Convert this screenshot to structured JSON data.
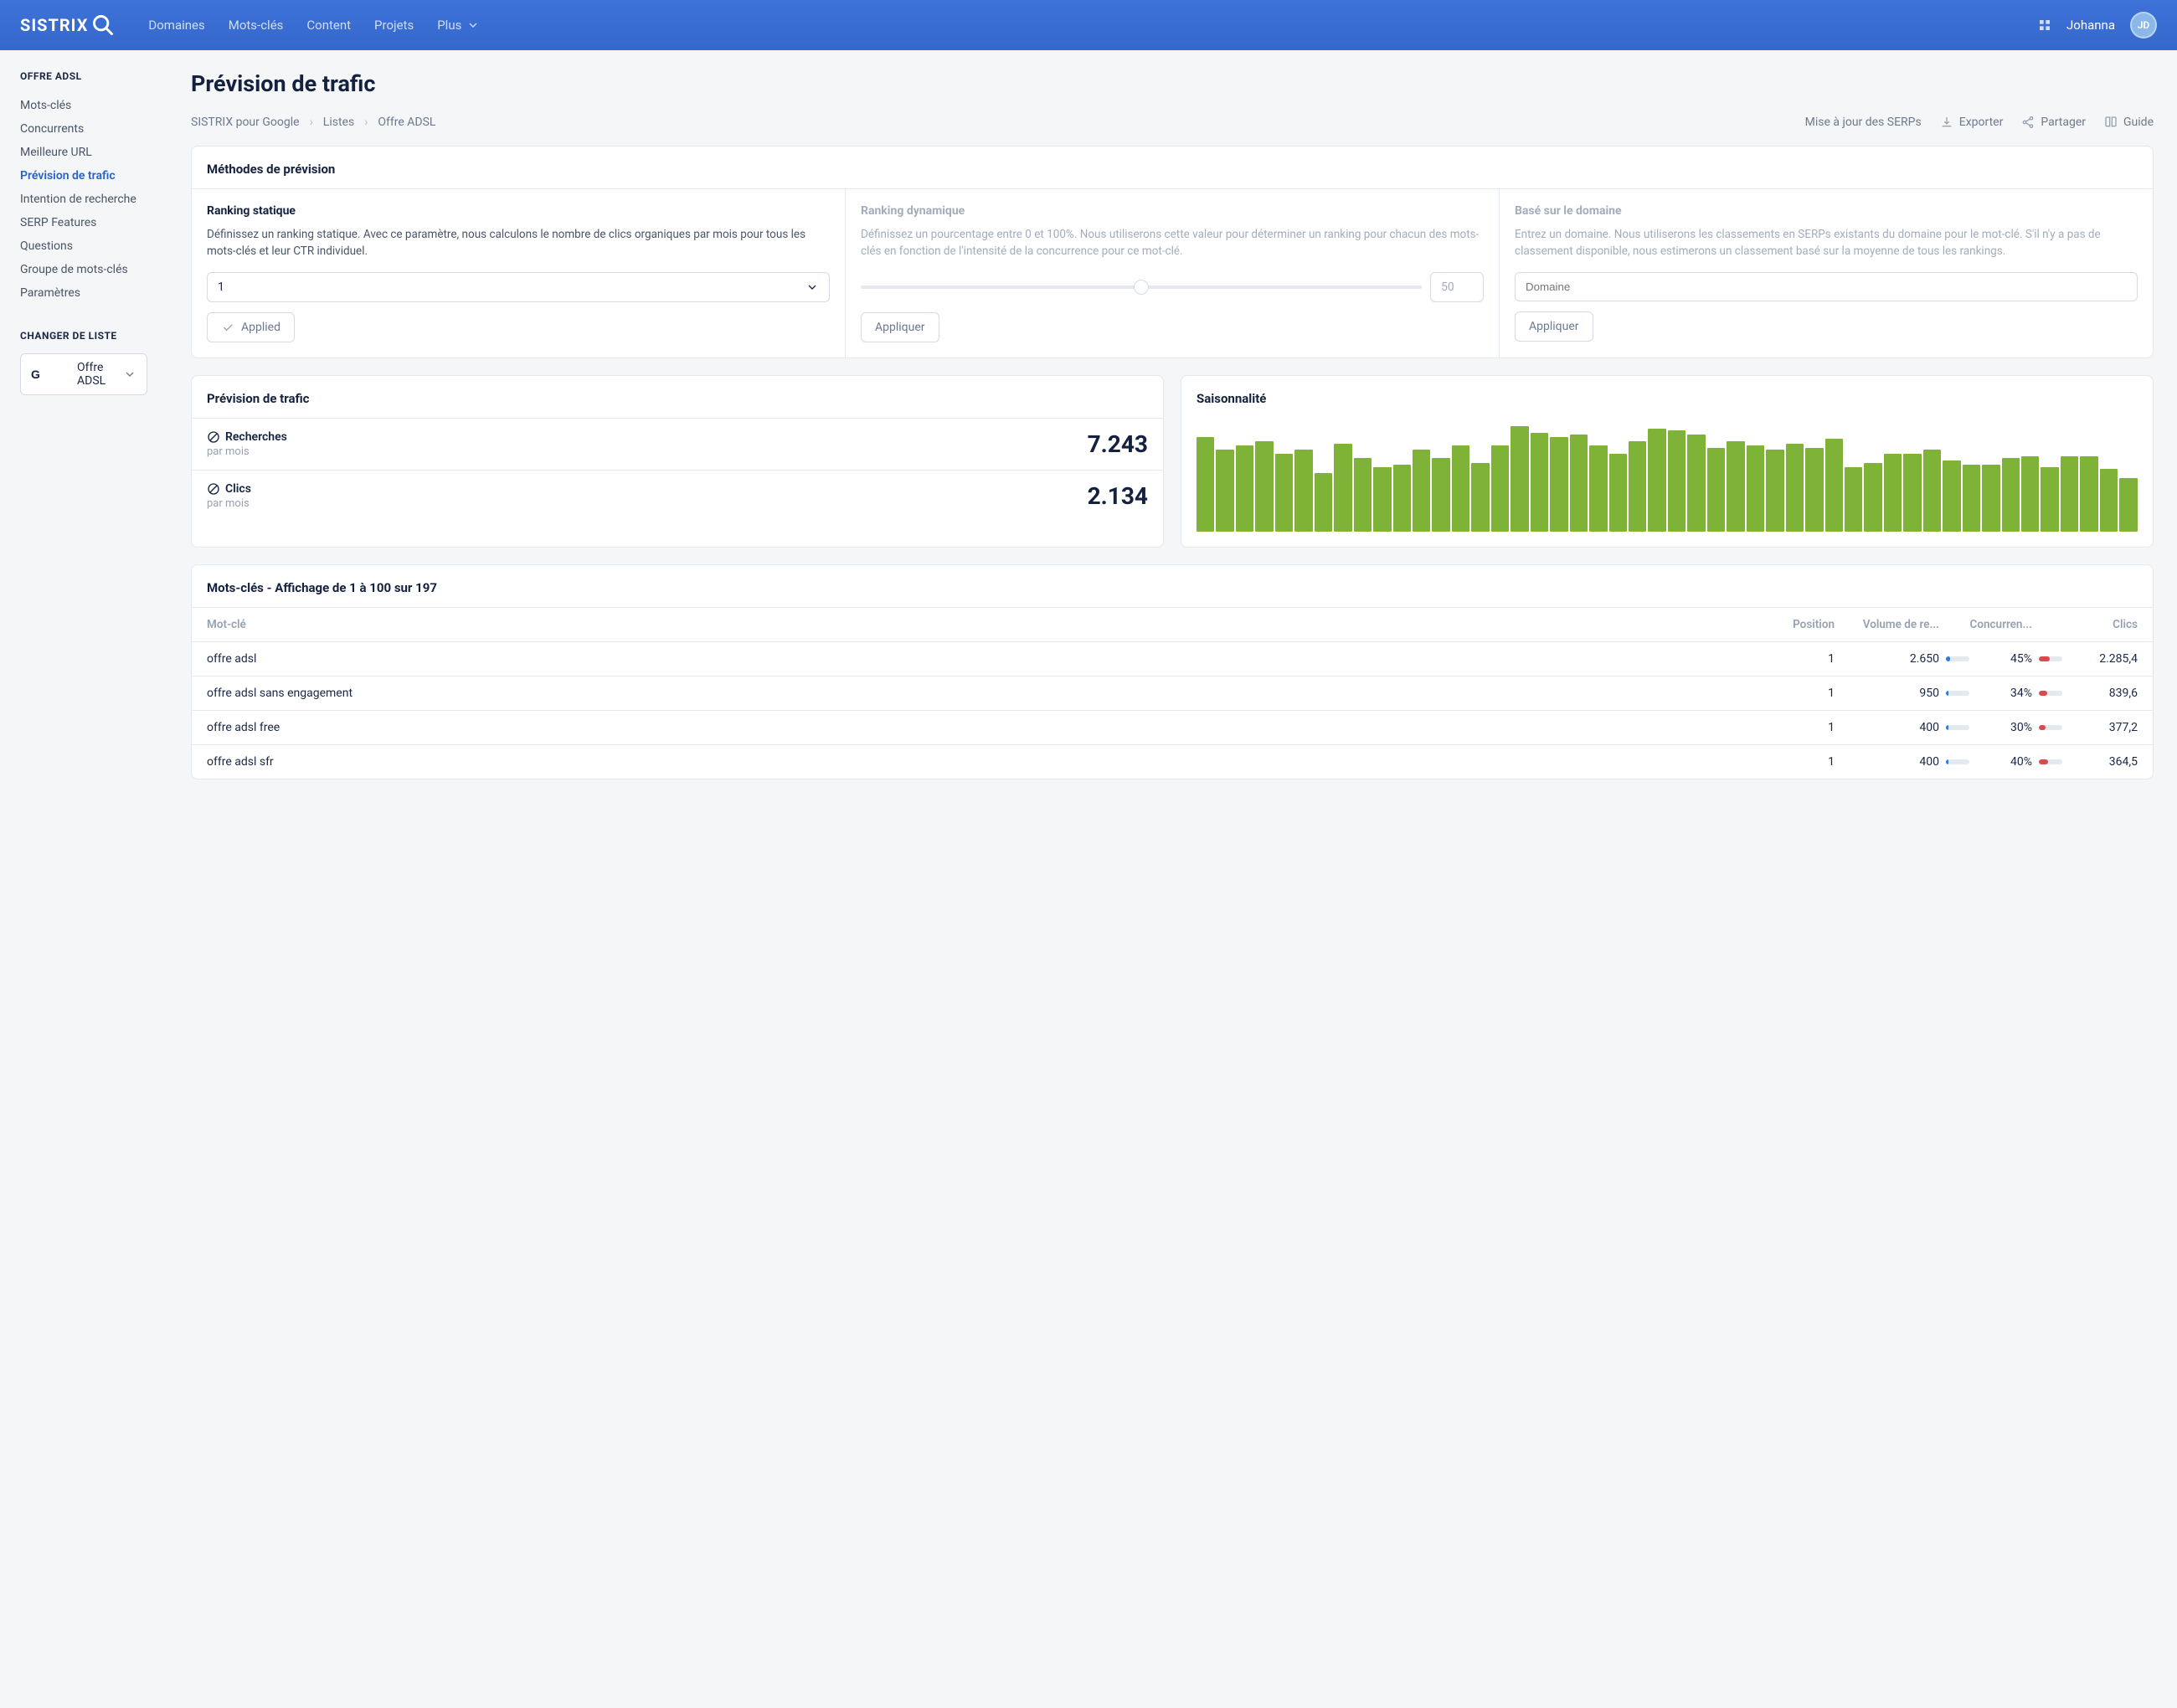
{
  "header": {
    "logo_text": "SISTRIX",
    "nav": [
      "Domaines",
      "Mots-clés",
      "Content",
      "Projets",
      "Plus"
    ],
    "username": "Johanna",
    "avatar_initials": "JD"
  },
  "sidebar": {
    "section1_title": "OFFRE ADSL",
    "items": [
      "Mots-clés",
      "Concurrents",
      "Meilleure URL",
      "Prévision de trafic",
      "Intention de recherche",
      "SERP Features",
      "Questions",
      "Groupe de mots-clés",
      "Paramètres"
    ],
    "active_index": 3,
    "section2_title": "CHANGER DE LISTE",
    "list_selected": "Offre ADSL"
  },
  "page": {
    "title": "Prévision de trafic",
    "breadcrumb": [
      "SISTRIX pour Google",
      "Listes",
      "Offre ADSL"
    ],
    "serp_update": "Mise à jour des SERPs",
    "actions": {
      "export": "Exporter",
      "share": "Partager",
      "guide": "Guide"
    }
  },
  "methods_card": {
    "title": "Méthodes de prévision",
    "static": {
      "title": "Ranking statique",
      "desc": "Définissez un ranking statique. Avec ce paramètre, nous calculons le nombre de clics organiques par mois pour tous les mots-clés et leur CTR individuel.",
      "select_value": "1",
      "applied_label": "Applied"
    },
    "dynamic": {
      "title": "Ranking dynamique",
      "desc": "Définissez un pourcentage entre 0 et 100%. Nous utiliserons cette valeur pour déterminer un ranking pour chacun des mots-clés en fonction de l'intensité de la concurrence pour ce mot-clé.",
      "slider_value": "50",
      "apply_label": "Appliquer"
    },
    "domain": {
      "title": "Basé sur le domaine",
      "desc": "Entrez un domaine. Nous utiliserons les classements en SERPs existants du domaine pour le mot-clé. S'il n'y a pas de classement disponible, nous estimerons un classement basé sur la moyenne de tous les rankings.",
      "placeholder": "Domaine",
      "apply_label": "Appliquer"
    }
  },
  "forecast": {
    "title": "Prévision de trafic",
    "searches_label": "Recherches",
    "per_month": "par mois",
    "searches_value": "7.243",
    "clicks_label": "Clics",
    "clicks_value": "2.134"
  },
  "seasonality": {
    "title": "Saisonnalité"
  },
  "chart_data": {
    "type": "bar",
    "title": "Saisonnalité",
    "x": "48 consecutive periods",
    "values_normalized": [
      88,
      76,
      80,
      84,
      72,
      76,
      54,
      82,
      68,
      60,
      62,
      76,
      68,
      80,
      64,
      80,
      98,
      92,
      88,
      90,
      80,
      72,
      84,
      96,
      94,
      90,
      78,
      84,
      80,
      76,
      82,
      78,
      86,
      60,
      64,
      72,
      72,
      76,
      66,
      62,
      62,
      68,
      70,
      60,
      70,
      70,
      58,
      50
    ],
    "ylim": [
      0,
      100
    ],
    "note": "heights are relative percentages (no axis labels visible in source)"
  },
  "table": {
    "title": "Mots-clés - Affichage de 1 à 100 sur 197",
    "headers": {
      "keyword": "Mot-clé",
      "position": "Position",
      "volume": "Volume de re...",
      "competition": "Concurren...",
      "clicks": "Clics"
    },
    "rows": [
      {
        "keyword": "offre adsl",
        "position": "1",
        "volume": "2.650",
        "vol_bar": 18,
        "competition": "45%",
        "comp_bar": 45,
        "clicks": "2.285,4"
      },
      {
        "keyword": "offre adsl sans engagement",
        "position": "1",
        "volume": "950",
        "vol_bar": 12,
        "competition": "34%",
        "comp_bar": 34,
        "clicks": "839,6"
      },
      {
        "keyword": "offre adsl free",
        "position": "1",
        "volume": "400",
        "vol_bar": 10,
        "competition": "30%",
        "comp_bar": 30,
        "clicks": "377,2"
      },
      {
        "keyword": "offre adsl sfr",
        "position": "1",
        "volume": "400",
        "vol_bar": 10,
        "competition": "40%",
        "comp_bar": 40,
        "clicks": "364,5"
      }
    ]
  }
}
